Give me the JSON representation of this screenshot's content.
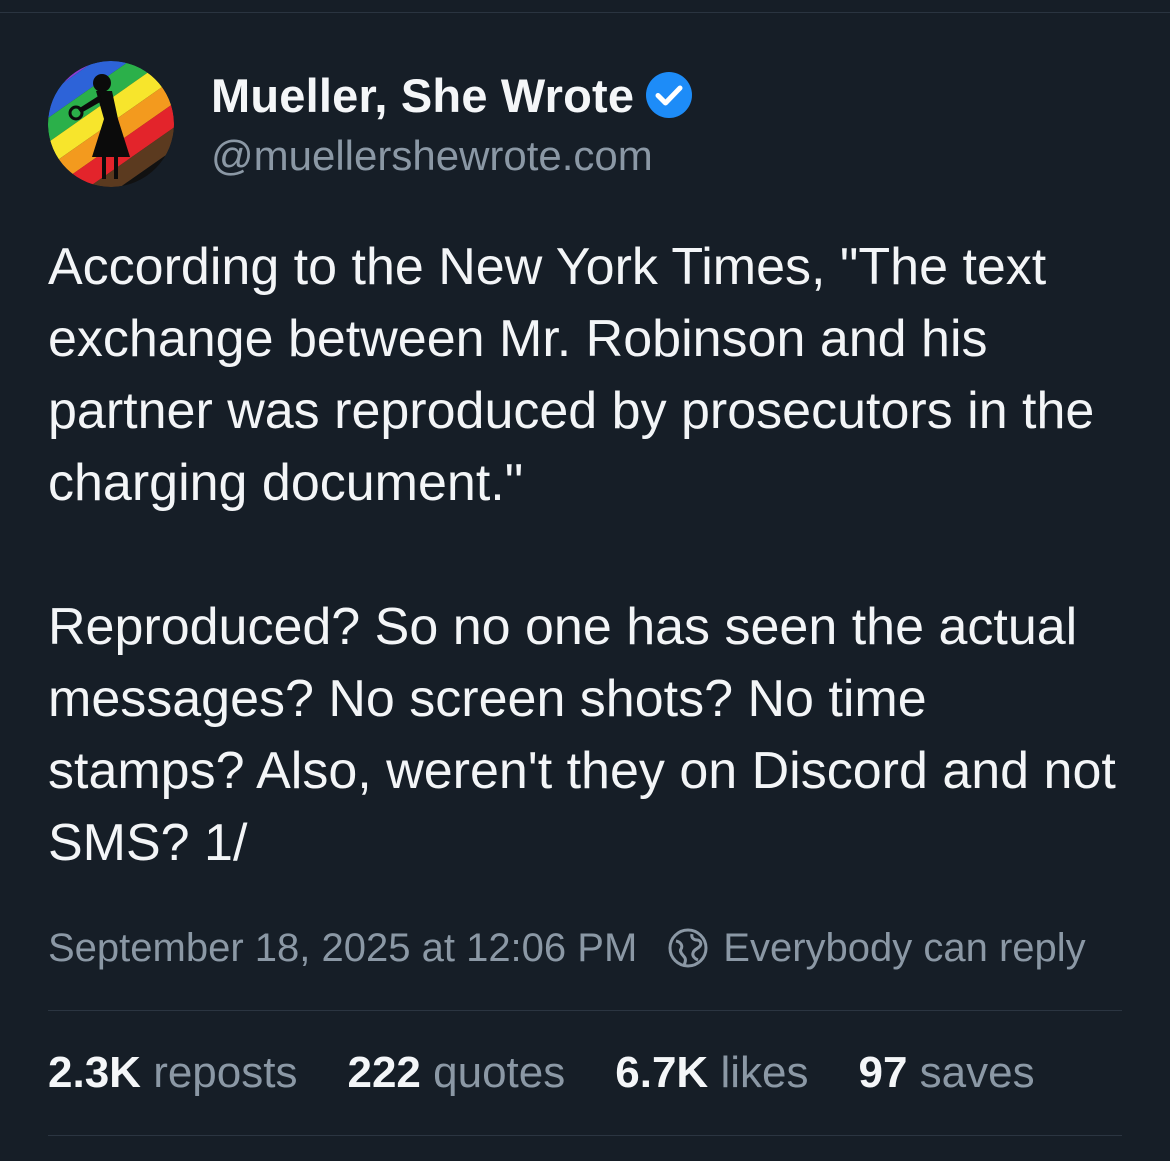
{
  "post": {
    "display_name": "Mueller, She Wrote",
    "handle": "@muellershewrote.com",
    "verified": true,
    "text": "According to the New York Times, \"The text exchange between Mr. Robinson and his partner was reproduced by prosecutors in the charging document.\"\n\nReproduced? So no one has seen the actual messages? No screen shots? No time stamps? Also, weren't they on Discord and not SMS? 1/",
    "timestamp": "September 18, 2025 at 12:06 PM",
    "reply_setting": "Everybody can reply"
  },
  "stats": [
    {
      "count": "2.3K",
      "label": "reposts"
    },
    {
      "count": "222",
      "label": "quotes"
    },
    {
      "count": "6.7K",
      "label": "likes"
    },
    {
      "count": "97",
      "label": "saves"
    }
  ],
  "icons": {
    "verified": "verified-badge-icon",
    "reply": "globe-icon"
  },
  "colors": {
    "background": "#161e27",
    "text": "#f3f5f7",
    "muted": "#8b98a5",
    "verified": "#1d8cf8"
  }
}
